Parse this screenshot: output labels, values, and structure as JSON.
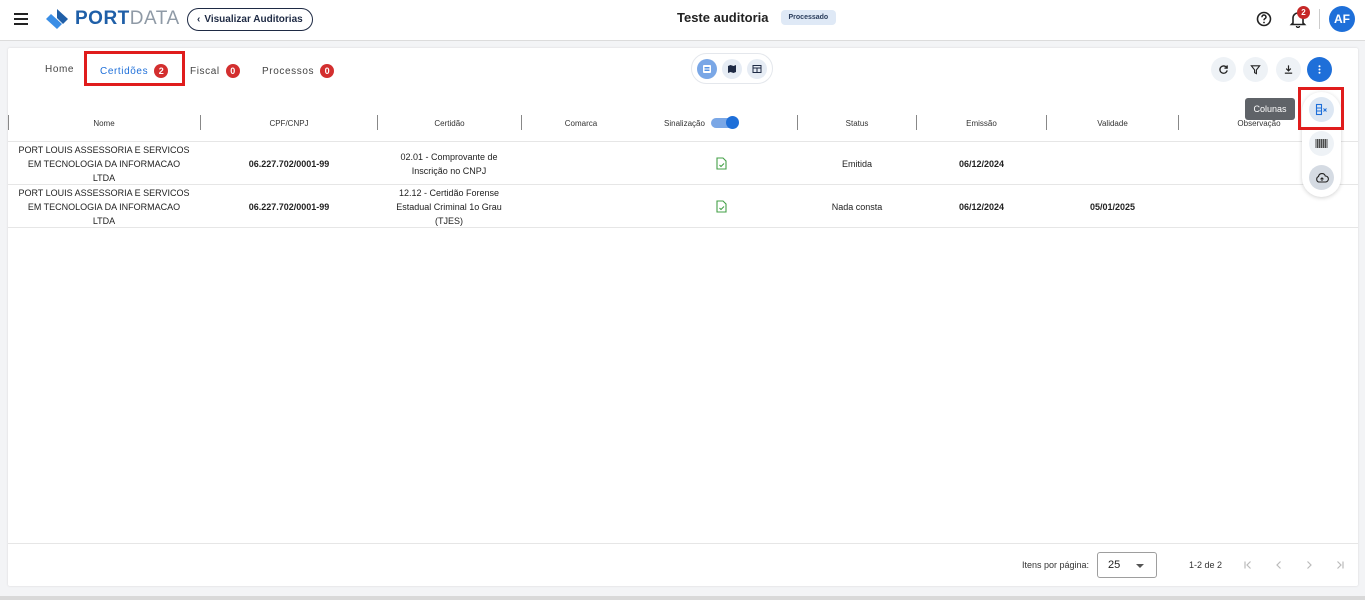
{
  "header": {
    "brand_port": "PORT",
    "brand_data": "DATA",
    "back_label": "Visualizar Auditorias",
    "title": "Teste auditoria",
    "status_chip": "Processado",
    "notifications_count": "2",
    "avatar_initials": "AF"
  },
  "tabs": [
    {
      "label": "Home",
      "badge": ""
    },
    {
      "label": "Certidões",
      "badge": "2"
    },
    {
      "label": "Fiscal",
      "badge": "0"
    },
    {
      "label": "Processos",
      "badge": "0"
    }
  ],
  "tooltip": "Colunas",
  "table": {
    "columns": [
      "Nome",
      "CPF/CNPJ",
      "Certidão",
      "Comarca",
      "Sinalização",
      "Status",
      "Emissão",
      "Validade",
      "Observação"
    ],
    "rows": [
      {
        "nome": "PORT LOUIS ASSESSORIA E SERVICOS EM TECNOLOGIA DA INFORMACAO LTDA",
        "cnpj": "06.227.702/0001-99",
        "certidao": "02.01 - Comprovante de Inscrição no CNPJ",
        "comarca": "",
        "status": "Emitida",
        "emissao": "06/12/2024",
        "validade": "",
        "observacao": ""
      },
      {
        "nome": "PORT LOUIS ASSESSORIA E SERVICOS EM TECNOLOGIA DA INFORMACAO LTDA",
        "cnpj": "06.227.702/0001-99",
        "certidao": "12.12 - Certidão Forense Estadual Criminal 1o Grau (TJES)",
        "comarca": "",
        "status": "Nada consta",
        "emissao": "06/12/2024",
        "validade": "05/01/2025",
        "observacao": ""
      }
    ]
  },
  "pagination": {
    "items_per_page_label": "Itens por página:",
    "items_per_page": "25",
    "range": "1-2 de 2"
  },
  "colors": {
    "primary": "#1e6fd9",
    "badge": "#d32f2f",
    "highlight": "#e01c1c",
    "doc_icon": "#43a047"
  }
}
